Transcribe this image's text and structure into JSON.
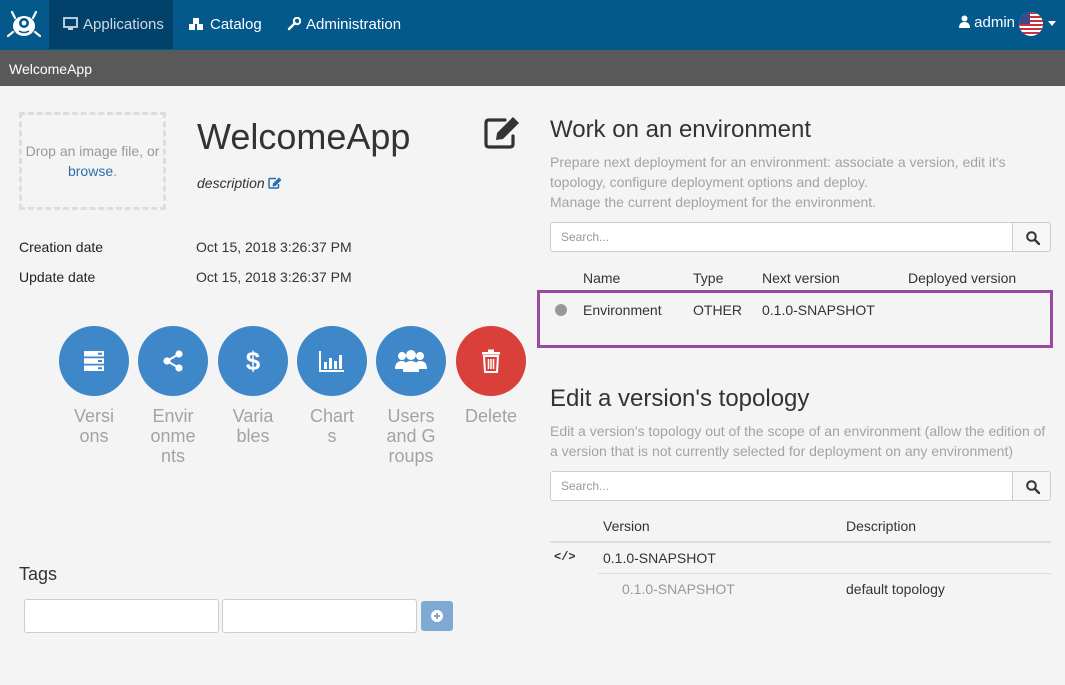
{
  "navbar": {
    "items": [
      {
        "label": "Applications",
        "icon": "desktop-icon",
        "active": true
      },
      {
        "label": "Catalog",
        "icon": "cubes-icon"
      },
      {
        "label": "Administration",
        "icon": "wrench-icon"
      }
    ],
    "user": "admin",
    "language_icon": "us-flag-icon"
  },
  "breadcrumb": "WelcomeApp",
  "dropzone": {
    "text": "Drop an image file, or",
    "link": "browse",
    "suffix": "."
  },
  "app": {
    "title": "WelcomeApp",
    "description": "description",
    "creation_label": "Creation date",
    "creation_value": "Oct 15, 2018 3:26:37 PM",
    "update_label": "Update date",
    "update_value": "Oct 15, 2018 3:26:37 PM"
  },
  "actions": [
    {
      "label": "Versions",
      "icon": "server-icon"
    },
    {
      "label": "Environments",
      "icon": "share-icon"
    },
    {
      "label": "Variables",
      "icon": "dollar-icon"
    },
    {
      "label": "Charts",
      "icon": "bar-chart-icon"
    },
    {
      "label": "Users and Groups",
      "icon": "users-icon"
    },
    {
      "label": "Delete",
      "icon": "trash-icon",
      "color": "#d9403a"
    }
  ],
  "tags": {
    "title": "Tags"
  },
  "environments": {
    "title": "Work on an environment",
    "desc1": "Prepare next deployment for an environment: associate a version, edit it's topology, configure deployment options and deploy.",
    "desc2": "Manage the current deployment for the environment.",
    "search_placeholder": "Search...",
    "columns": [
      "Name",
      "Type",
      "Next version",
      "Deployed version"
    ],
    "rows": [
      {
        "status": "grey",
        "name": "Environment",
        "type": "OTHER",
        "next_version": "0.1.0-SNAPSHOT",
        "deployed_version": ""
      }
    ]
  },
  "topology": {
    "title": "Edit a version's topology",
    "desc": "Edit a version's topology out of the scope of an environment (allow the edition of a version that is not currently selected for deployment on any environment)",
    "search_placeholder": "Search...",
    "columns": [
      "Version",
      "Description"
    ],
    "group_label": "0.1.0-SNAPSHOT",
    "rows": [
      {
        "version": "0.1.0-SNAPSHOT",
        "description": "default topology"
      }
    ]
  },
  "colors": {
    "navbar": "#03588c",
    "breadcrumb": "#595959",
    "primary": "#3e87c9",
    "danger": "#d9403a",
    "highlight": "#9a4aa0"
  }
}
